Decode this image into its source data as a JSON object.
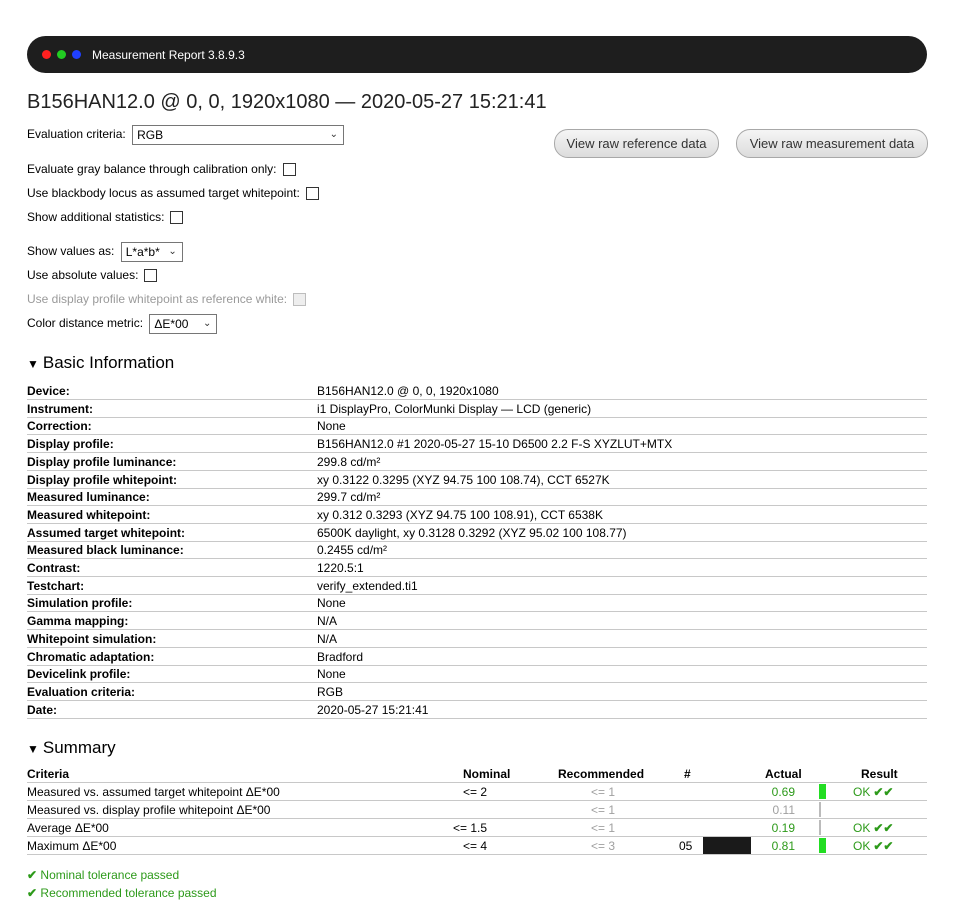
{
  "window": {
    "title": "Measurement Report 3.8.9.3",
    "dot_colors": [
      "#ff2020",
      "#22cc22",
      "#2040ff"
    ]
  },
  "heading": "B156HAN12.0 @ 0, 0, 1920x1080 — 2020-05-27 15:21:41",
  "options": {
    "evaluation_criteria_label": "Evaluation criteria:",
    "evaluation_criteria_value": "RGB",
    "gray_balance_label": "Evaluate gray balance through calibration only:",
    "blackbody_label": "Use blackbody locus as assumed target whitepoint:",
    "additional_stats_label": "Show additional statistics:",
    "show_values_label": "Show values as:",
    "show_values_value": "L*a*b*",
    "absolute_label": "Use absolute values:",
    "display_profile_wp_label": "Use display profile whitepoint as reference white:",
    "color_distance_label": "Color distance metric:",
    "color_distance_value": "ΔE*00"
  },
  "buttons": {
    "raw_reference": "View raw reference data",
    "raw_measurement": "View raw measurement data"
  },
  "basic_info": {
    "title": "Basic Information",
    "rows": [
      {
        "k": "Device:",
        "v": "B156HAN12.0 @ 0, 0, 1920x1080"
      },
      {
        "k": "Instrument:",
        "v": "i1 DisplayPro, ColorMunki Display — LCD (generic)"
      },
      {
        "k": "Correction:",
        "v": "None"
      },
      {
        "k": "Display profile:",
        "v": "B156HAN12.0 #1 2020-05-27 15-10 D6500 2.2 F-S XYZLUT+MTX"
      },
      {
        "k": "Display profile luminance:",
        "v": "299.8 cd/m²"
      },
      {
        "k": "Display profile whitepoint:",
        "v": "xy 0.3122 0.3295 (XYZ 94.75 100 108.74), CCT 6527K"
      },
      {
        "k": "Measured luminance:",
        "v": "299.7 cd/m²"
      },
      {
        "k": "Measured whitepoint:",
        "v": "xy 0.312 0.3293 (XYZ 94.75 100 108.91), CCT 6538K"
      },
      {
        "k": "Assumed target whitepoint:",
        "v": "6500K daylight, xy 0.3128 0.3292 (XYZ 95.02 100 108.77)"
      },
      {
        "k": "Measured black luminance:",
        "v": "0.2455 cd/m²"
      },
      {
        "k": "Contrast:",
        "v": "1220.5:1"
      },
      {
        "k": "Testchart:",
        "v": "verify_extended.ti1"
      },
      {
        "k": "Simulation profile:",
        "v": "None"
      },
      {
        "k": "Gamma mapping:",
        "v": "N/A"
      },
      {
        "k": "Whitepoint simulation:",
        "v": "N/A"
      },
      {
        "k": "Chromatic adaptation:",
        "v": "Bradford"
      },
      {
        "k": "Devicelink profile:",
        "v": "None"
      },
      {
        "k": "Evaluation criteria:",
        "v": "RGB"
      },
      {
        "k": "Date:",
        "v": "2020-05-27 15:21:41"
      }
    ]
  },
  "summary": {
    "title": "Summary",
    "headers": {
      "criteria": "Criteria",
      "nominal": "Nominal",
      "recommended": "Recommended",
      "num": "#",
      "actual": "Actual",
      "result": "Result"
    },
    "rows": [
      {
        "criteria": "Measured vs. assumed target whitepoint ΔE*00",
        "nominal": "<= 2",
        "recommended": "<= 1",
        "num": "",
        "actual": "0.69",
        "result": "OK",
        "actual_green": true,
        "bar": "full",
        "swatch": false
      },
      {
        "criteria": "Measured vs. display profile whitepoint ΔE*00",
        "nominal": "",
        "recommended": "<= 1",
        "num": "",
        "actual": "0.11",
        "result": "",
        "actual_green": false,
        "bar": "thin",
        "swatch": false
      },
      {
        "criteria": "Average ΔE*00",
        "nominal": "<= 1.5",
        "recommended": "<= 1",
        "num": "",
        "actual": "0.19",
        "result": "OK",
        "actual_green": true,
        "bar": "thin",
        "swatch": false
      },
      {
        "criteria": "Maximum ΔE*00",
        "nominal": "<= 4",
        "recommended": "<= 3",
        "num": "05",
        "actual": "0.81",
        "result": "OK",
        "actual_green": true,
        "bar": "full",
        "swatch": true
      }
    ],
    "swatch_color": "#1a1a1a",
    "pass_nominal": "Nominal tolerance passed",
    "pass_recommended": "Recommended tolerance passed"
  }
}
